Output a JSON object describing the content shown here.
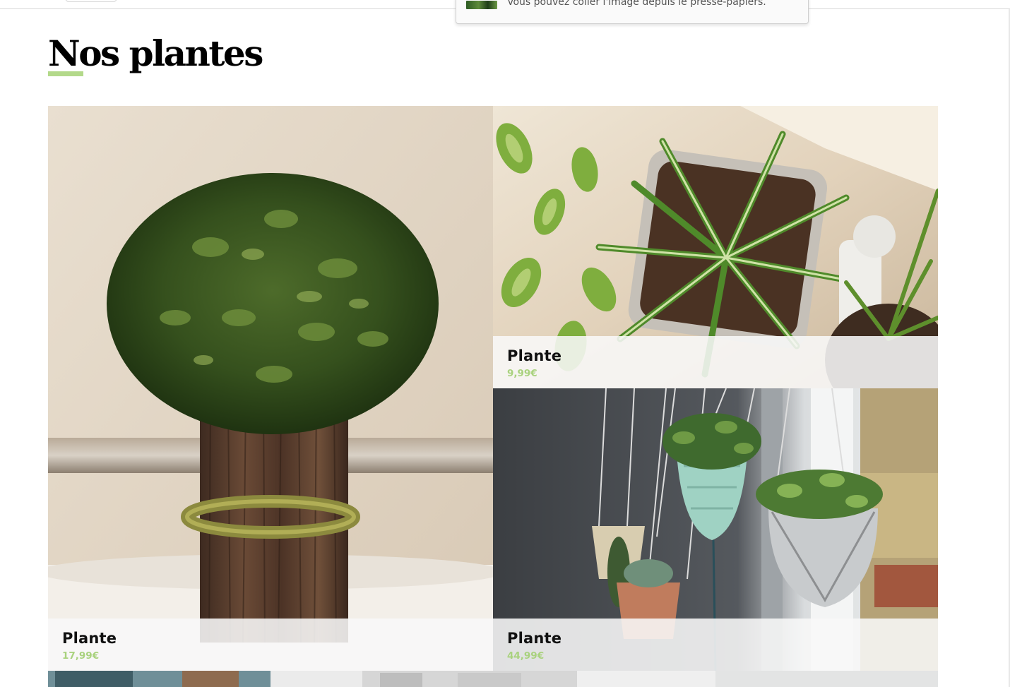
{
  "notification": {
    "message": "Vous pouvez coller l'image depuis le presse-papiers.",
    "thumbnail_icon": "image-thumbnail-icon"
  },
  "page": {
    "title": "Nos plantes",
    "accent_color": "#b3d98a"
  },
  "products": [
    {
      "name": "Plante",
      "price": "17,99€",
      "image": "boxwood-bundle-photo"
    },
    {
      "name": "Plante",
      "price": "9,99€",
      "image": "potted-spider-plants-photo"
    },
    {
      "name": "Plante",
      "price": "44,99€",
      "image": "hanging-planters-photo"
    }
  ]
}
